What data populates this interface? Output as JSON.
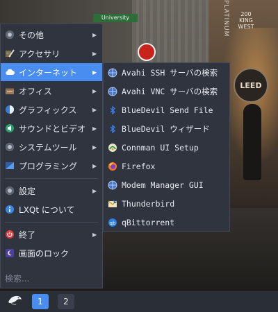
{
  "background": {
    "street_sign": "University",
    "building_sign": "PLATINUM",
    "king_sign": [
      "200",
      "KING",
      "WEST"
    ],
    "leed_sign": "LEED"
  },
  "menu": {
    "items": [
      {
        "label": "その他",
        "icon": "gear-icon",
        "has_submenu": true
      },
      {
        "label": "アクセサリ",
        "icon": "accessories-icon",
        "has_submenu": true
      },
      {
        "label": "インターネット",
        "icon": "cloud-icon",
        "has_submenu": true,
        "active": true
      },
      {
        "label": "オフィス",
        "icon": "office-icon",
        "has_submenu": true
      },
      {
        "label": "グラフィックス",
        "icon": "graphics-icon",
        "has_submenu": true
      },
      {
        "label": "サウンドとビデオ",
        "icon": "sound-icon",
        "has_submenu": true
      },
      {
        "label": "システムツール",
        "icon": "system-tools-icon",
        "has_submenu": true
      },
      {
        "label": "プログラミング",
        "icon": "programming-icon",
        "has_submenu": true
      },
      {
        "label": "設定",
        "icon": "settings-icon",
        "has_submenu": true
      },
      {
        "label": "LXQt について",
        "icon": "info-icon",
        "has_submenu": false
      },
      {
        "label": "終了",
        "icon": "power-icon",
        "has_submenu": true
      },
      {
        "label": "画面のロック",
        "icon": "lock-screen-icon",
        "has_submenu": false
      }
    ],
    "search_placeholder": "検索..."
  },
  "submenu": {
    "items": [
      {
        "label": "Avahi SSH サーバの検索",
        "icon": "network-globe-icon"
      },
      {
        "label": "Avahi VNC サーバの検索",
        "icon": "network-globe-icon"
      },
      {
        "label": "BlueDevil Send File",
        "icon": "bluetooth-icon"
      },
      {
        "label": "BlueDevil ウィザード",
        "icon": "bluetooth-icon"
      },
      {
        "label": "Connman UI Setup",
        "icon": "connman-icon"
      },
      {
        "label": "Firefox",
        "icon": "firefox-icon"
      },
      {
        "label": "Modem Manager GUI",
        "icon": "modem-icon"
      },
      {
        "label": "Thunderbird",
        "icon": "thunderbird-icon"
      },
      {
        "label": "qBittorrent",
        "icon": "qbittorrent-icon"
      }
    ]
  },
  "taskbar": {
    "workspaces": [
      "1",
      "2"
    ],
    "active_workspace": "1"
  },
  "colors": {
    "menu_bg": "#2f343f",
    "accent": "#4a8df0",
    "taskbar_bg": "#2a2e37"
  }
}
